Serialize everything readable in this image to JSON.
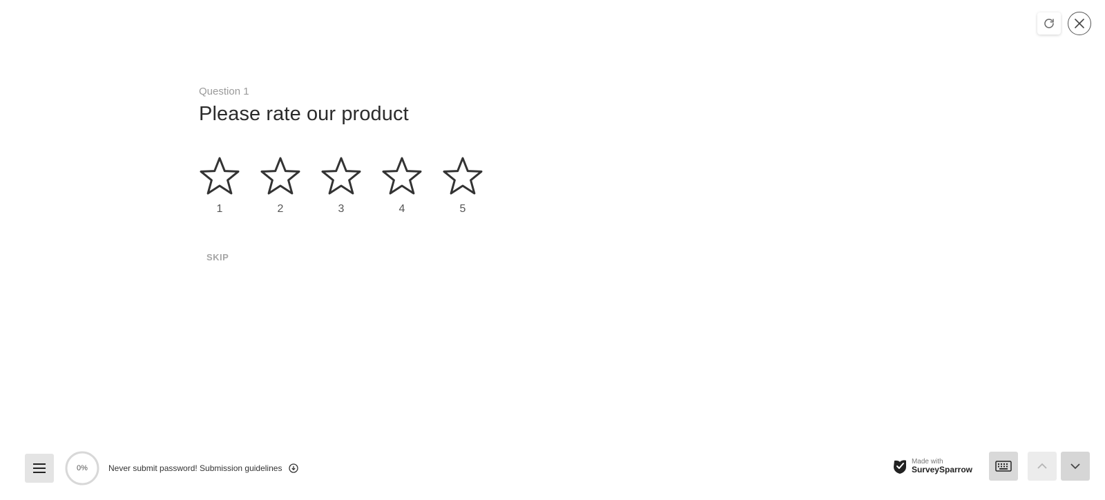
{
  "question": {
    "number": "Question 1",
    "title": "Please rate our product"
  },
  "rating": {
    "max": 5,
    "selected": 0,
    "options": [
      "1",
      "2",
      "3",
      "4",
      "5"
    ]
  },
  "skip_label": "SKIP",
  "progress": {
    "value": 0,
    "text": "0%"
  },
  "guidelines_text": "Never submit password! Submission guidelines",
  "brand": {
    "made_with": "Made with",
    "name": "SurveySparrow"
  },
  "icons": {
    "refresh": "refresh-icon",
    "close": "close-icon",
    "menu": "menu-icon",
    "download": "download-circle-icon",
    "keyboard": "keyboard-icon",
    "up": "chevron-up-icon",
    "down": "chevron-down-icon",
    "star": "star-outline-icon"
  }
}
